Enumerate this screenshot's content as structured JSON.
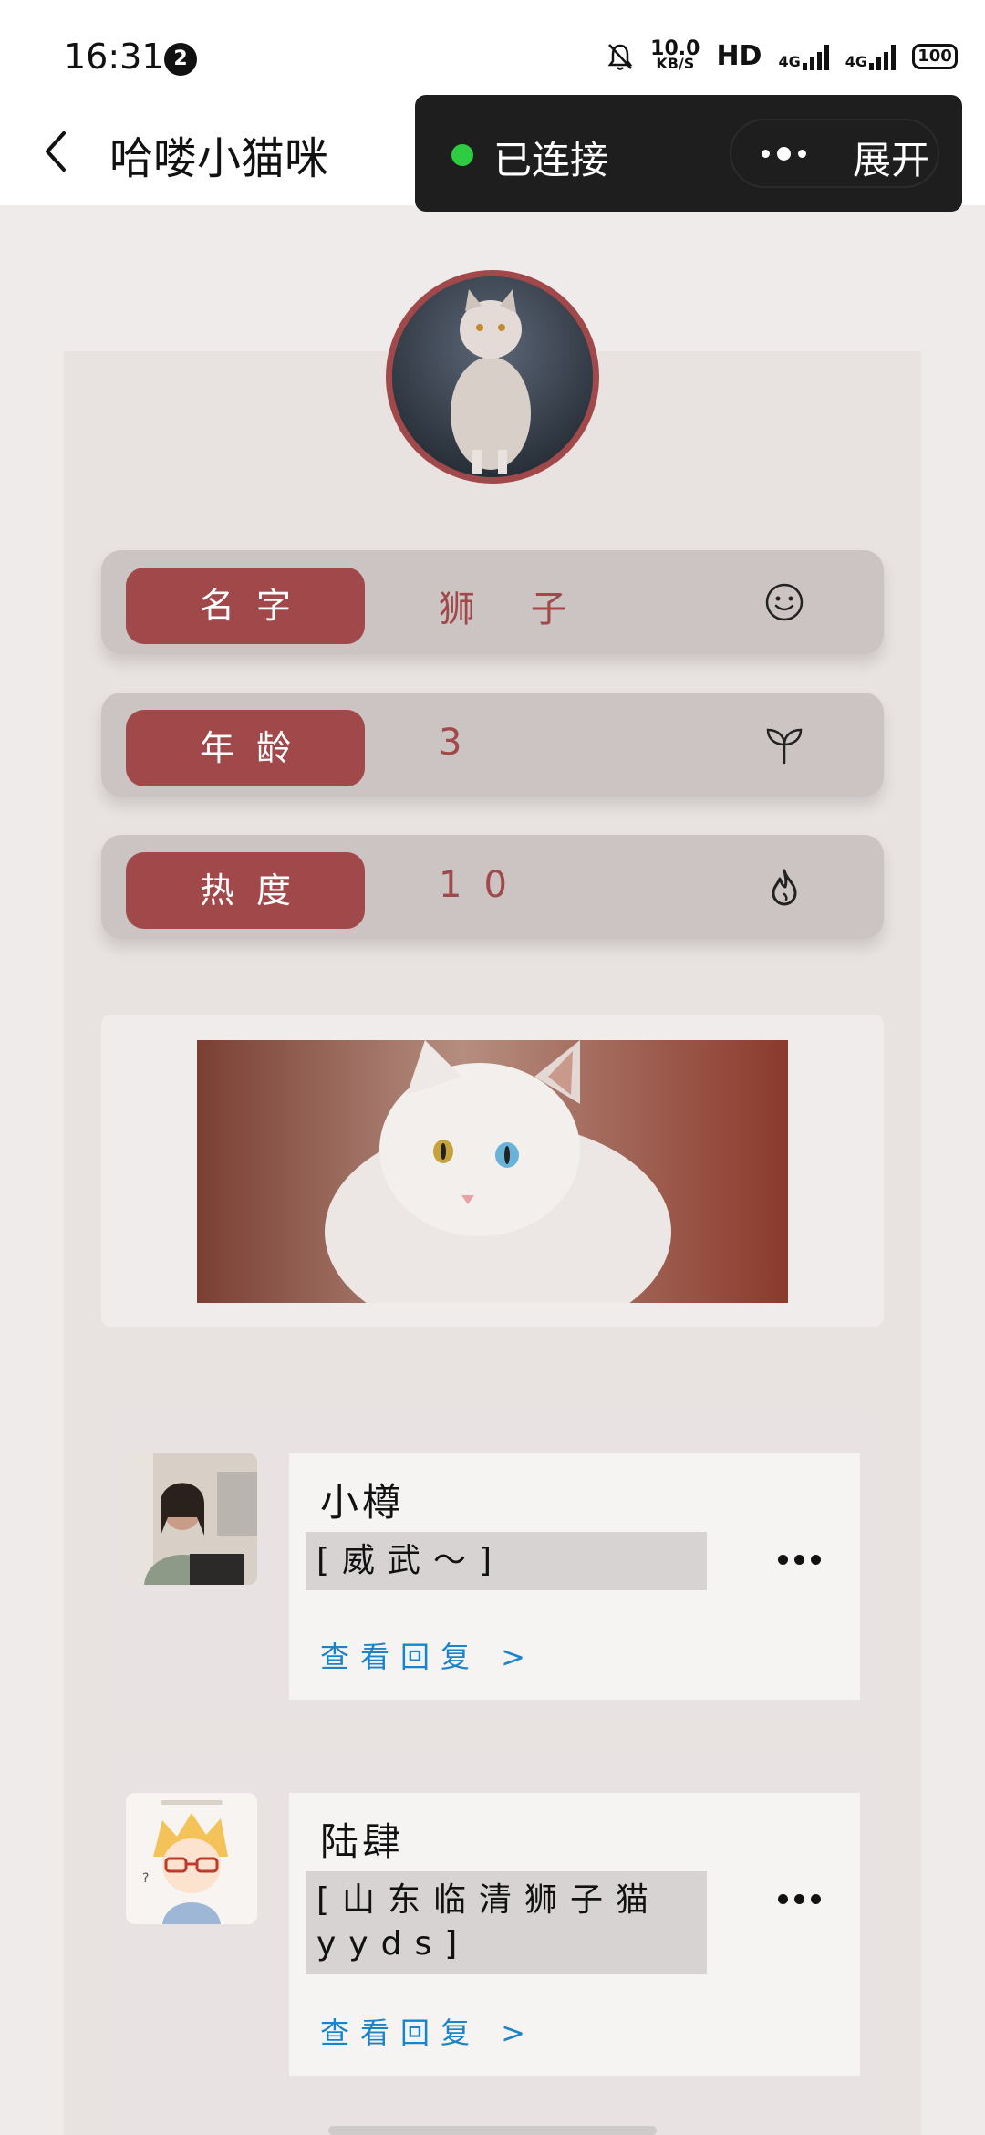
{
  "status_bar": {
    "time": "16:31",
    "notification_count": "2",
    "speed_value": "10.0",
    "speed_unit": "KB/S",
    "hd": "HD",
    "network1": "4G",
    "network2": "4G",
    "battery": "100"
  },
  "header": {
    "title": "哈喽小猫咪"
  },
  "connection": {
    "status": "已连接",
    "expand_label": "展开"
  },
  "cat_info": [
    {
      "label": "名字",
      "value": "狮 子",
      "icon": "smile-icon"
    },
    {
      "label": "年龄",
      "value": "3",
      "icon": "sprout-icon"
    },
    {
      "label": "热度",
      "value": "10",
      "icon": "flame-icon"
    }
  ],
  "comments": [
    {
      "name": "小樽",
      "text": "[威武～]",
      "reply_label": "查看回复 >"
    },
    {
      "name": "陆肆",
      "text": "[山东临清狮子猫yyds]",
      "reply_label": "查看回复 >"
    }
  ],
  "colors": {
    "accent": "#a0484a",
    "link": "#1b83c8",
    "connected": "#2ecc40"
  }
}
